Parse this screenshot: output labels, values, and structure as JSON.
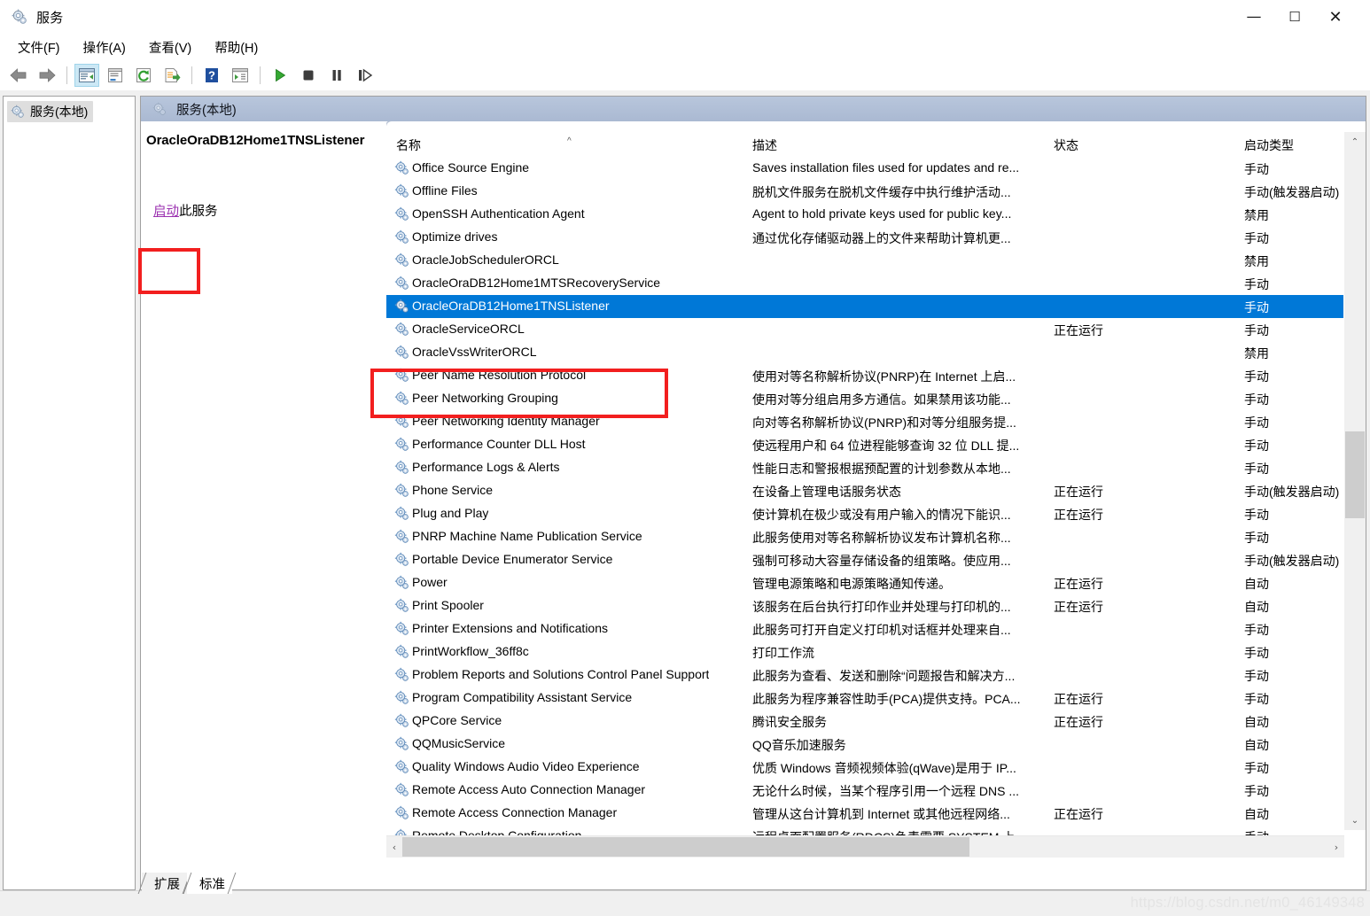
{
  "window": {
    "title": "服务",
    "icon": "services-gear-icon",
    "controls": {
      "minimize": "—",
      "maximize": "☐",
      "close": "✕"
    }
  },
  "menubar": {
    "items": [
      {
        "label": "文件(F)",
        "name": "menu-file"
      },
      {
        "label": "操作(A)",
        "name": "menu-action"
      },
      {
        "label": "查看(V)",
        "name": "menu-view"
      },
      {
        "label": "帮助(H)",
        "name": "menu-help"
      }
    ]
  },
  "toolbar": {
    "buttons": [
      {
        "name": "back-icon",
        "glyph": "back"
      },
      {
        "name": "forward-icon",
        "glyph": "forward"
      },
      {
        "name": "show-hide-tree-icon",
        "glyph": "treepane",
        "active": true
      },
      {
        "name": "properties-icon",
        "glyph": "properties"
      },
      {
        "name": "refresh-icon",
        "glyph": "refresh"
      },
      {
        "name": "export-list-icon",
        "glyph": "export"
      },
      {
        "name": "help-icon",
        "glyph": "help"
      },
      {
        "name": "show-action-pane-icon",
        "glyph": "actionpane"
      },
      {
        "name": "start-service-icon",
        "glyph": "play"
      },
      {
        "name": "stop-service-icon",
        "glyph": "stop"
      },
      {
        "name": "pause-service-icon",
        "glyph": "pause"
      },
      {
        "name": "restart-service-icon",
        "glyph": "restart"
      }
    ]
  },
  "tree": {
    "root": {
      "label": "服务(本地)",
      "icon": "services-gear-icon",
      "selected": true
    }
  },
  "pane": {
    "header_title": "服务(本地)",
    "header_icon": "services-gear-icon"
  },
  "details": {
    "service_name": "OracleOraDB12Home1TNSListener",
    "action_link": "启动",
    "action_suffix": "此服务"
  },
  "columns": {
    "name": "名称",
    "description": "描述",
    "status": "状态",
    "startup_type": "启动类型",
    "sort_indicator": "^"
  },
  "rows": [
    {
      "name": "Office  Source Engine",
      "desc": "Saves installation files used for updates and re...",
      "status": "",
      "startup": "手动"
    },
    {
      "name": "Offline Files",
      "desc": "脱机文件服务在脱机文件缓存中执行维护活动...",
      "status": "",
      "startup": "手动(触发器启动)"
    },
    {
      "name": "OpenSSH Authentication Agent",
      "desc": "Agent to hold private keys used for public key...",
      "status": "",
      "startup": "禁用"
    },
    {
      "name": "Optimize drives",
      "desc": "通过优化存储驱动器上的文件来帮助计算机更...",
      "status": "",
      "startup": "手动"
    },
    {
      "name": "OracleJobSchedulerORCL",
      "desc": "",
      "status": "",
      "startup": "禁用"
    },
    {
      "name": "OracleOraDB12Home1MTSRecoveryService",
      "desc": "",
      "status": "",
      "startup": "手动"
    },
    {
      "name": "OracleOraDB12Home1TNSListener",
      "desc": "",
      "status": "",
      "startup": "手动",
      "selected": true
    },
    {
      "name": "OracleServiceORCL",
      "desc": "",
      "status": "正在运行",
      "startup": "手动"
    },
    {
      "name": "OracleVssWriterORCL",
      "desc": "",
      "status": "",
      "startup": "禁用"
    },
    {
      "name": "Peer Name Resolution Protocol",
      "desc": "使用对等名称解析协议(PNRP)在 Internet 上启...",
      "status": "",
      "startup": "手动"
    },
    {
      "name": "Peer Networking Grouping",
      "desc": "使用对等分组启用多方通信。如果禁用该功能...",
      "status": "",
      "startup": "手动"
    },
    {
      "name": "Peer Networking Identity Manager",
      "desc": "向对等名称解析协议(PNRP)和对等分组服务提...",
      "status": "",
      "startup": "手动"
    },
    {
      "name": "Performance Counter DLL Host",
      "desc": "使远程用户和 64 位进程能够查询 32 位 DLL 提...",
      "status": "",
      "startup": "手动"
    },
    {
      "name": "Performance Logs & Alerts",
      "desc": "性能日志和警报根据预配置的计划参数从本地...",
      "status": "",
      "startup": "手动"
    },
    {
      "name": "Phone Service",
      "desc": "在设备上管理电话服务状态",
      "status": "正在运行",
      "startup": "手动(触发器启动)"
    },
    {
      "name": "Plug and Play",
      "desc": "使计算机在极少或没有用户输入的情况下能识...",
      "status": "正在运行",
      "startup": "手动"
    },
    {
      "name": "PNRP Machine Name Publication Service",
      "desc": "此服务使用对等名称解析协议发布计算机名称...",
      "status": "",
      "startup": "手动"
    },
    {
      "name": "Portable Device Enumerator Service",
      "desc": "强制可移动大容量存储设备的组策略。使应用...",
      "status": "",
      "startup": "手动(触发器启动)"
    },
    {
      "name": "Power",
      "desc": "管理电源策略和电源策略通知传递。",
      "status": "正在运行",
      "startup": "自动"
    },
    {
      "name": "Print Spooler",
      "desc": "该服务在后台执行打印作业并处理与打印机的...",
      "status": "正在运行",
      "startup": "自动"
    },
    {
      "name": "Printer Extensions and Notifications",
      "desc": "此服务可打开自定义打印机对话框并处理来自...",
      "status": "",
      "startup": "手动"
    },
    {
      "name": "PrintWorkflow_36ff8c",
      "desc": "打印工作流",
      "status": "",
      "startup": "手动"
    },
    {
      "name": "Problem Reports and Solutions Control Panel Support",
      "desc": "此服务为查看、发送和删除“问题报告和解决方...",
      "status": "",
      "startup": "手动"
    },
    {
      "name": "Program Compatibility Assistant Service",
      "desc": "此服务为程序兼容性助手(PCA)提供支持。PCA...",
      "status": "正在运行",
      "startup": "手动"
    },
    {
      "name": "QPCore Service",
      "desc": "腾讯安全服务",
      "status": "正在运行",
      "startup": "自动"
    },
    {
      "name": "QQMusicService",
      "desc": "QQ音乐加速服务",
      "status": "",
      "startup": "自动"
    },
    {
      "name": "Quality Windows Audio Video Experience",
      "desc": "优质 Windows 音频视频体验(qWave)是用于 IP...",
      "status": "",
      "startup": "手动"
    },
    {
      "name": "Remote Access Auto Connection Manager",
      "desc": "无论什么时候，当某个程序引用一个远程 DNS ...",
      "status": "",
      "startup": "手动"
    },
    {
      "name": "Remote Access Connection Manager",
      "desc": "管理从这台计算机到 Internet 或其他远程网络...",
      "status": "正在运行",
      "startup": "自动"
    },
    {
      "name": "Remote Desktop Configuration",
      "desc": "远程桌面配置服务(RDCS)负责需要 SYSTEM 上...",
      "status": "",
      "startup": "手动"
    }
  ],
  "tabs": [
    {
      "label": "扩展",
      "name": "tab-extended",
      "active": false
    },
    {
      "label": "标准",
      "name": "tab-standard",
      "active": true
    }
  ],
  "scrollbars": {
    "vertical": {
      "up_arrow": "⌃",
      "down_arrow": "⌄"
    },
    "horizontal": {
      "left_arrow": "‹",
      "right_arrow": "›"
    }
  },
  "watermark": "https://blog.csdn.net/m0_46149348",
  "colors": {
    "selection_blue": "#0078d7",
    "annotation_red": "#f21f1f",
    "link_purple": "#9b30b0",
    "pane_header": "#b0bfd6"
  }
}
